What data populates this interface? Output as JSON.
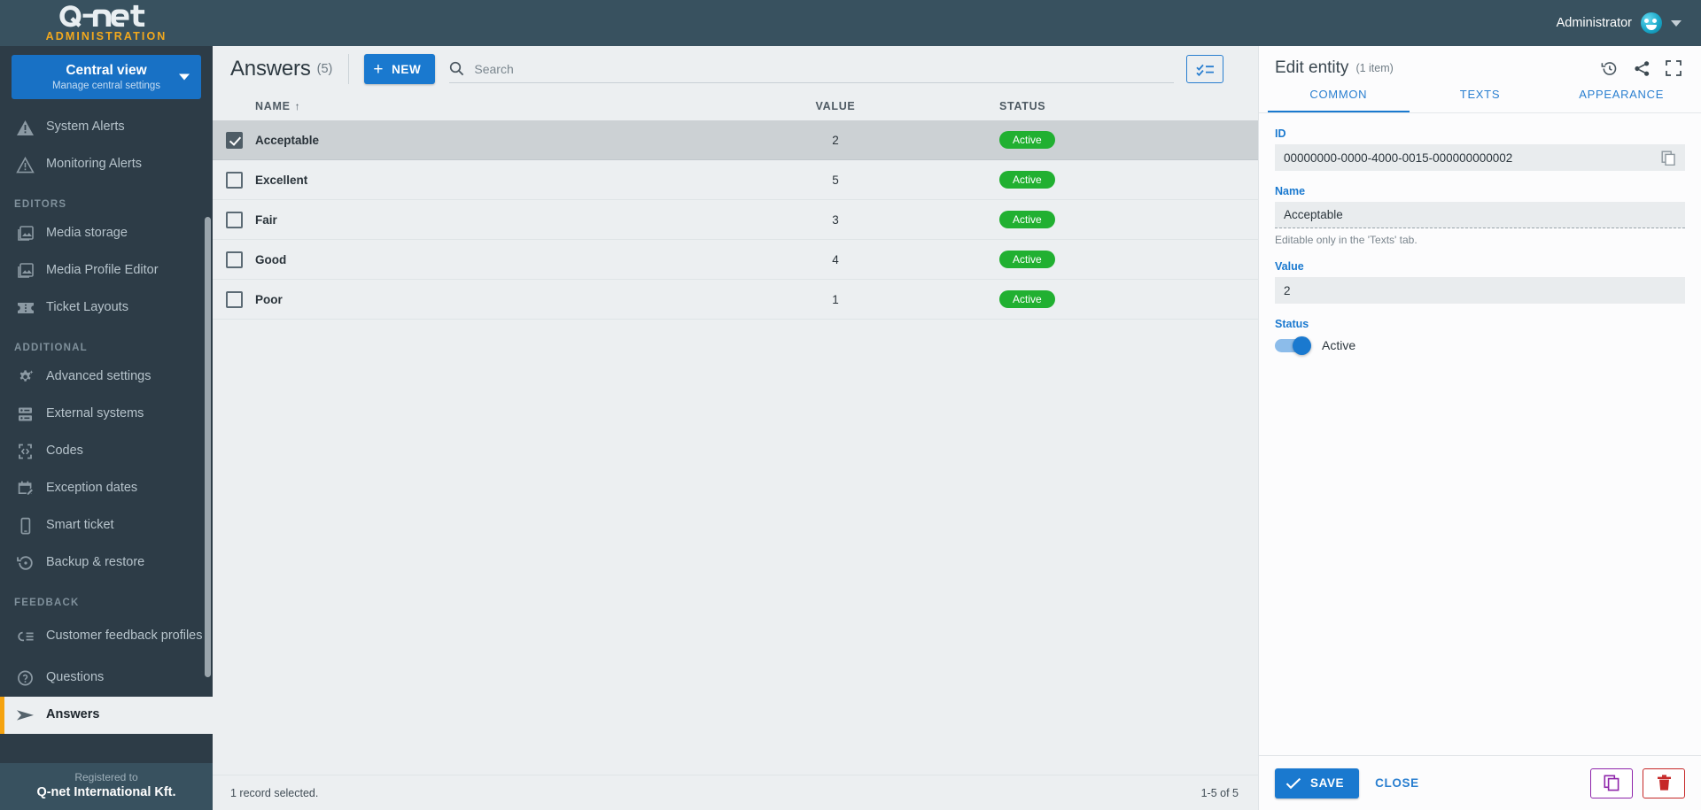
{
  "brand": {
    "logo_main": "Q⌐net",
    "logo_sub": "ADMINISTRATION"
  },
  "topbar": {
    "user_label": "Administrator",
    "avatar_icon": "smiley-avatar-icon",
    "caret_icon": "chevron-down-icon"
  },
  "sidebar": {
    "view_switch": {
      "title": "Central view",
      "subtitle": "Manage central settings",
      "caret_icon": "chevron-down-icon"
    },
    "items": [
      {
        "label": "System Alerts",
        "icon": "alert-filled-icon",
        "group": null,
        "active": false
      },
      {
        "label": "Monitoring Alerts",
        "icon": "alert-outline-icon",
        "group": null,
        "active": false
      }
    ],
    "groups": [
      {
        "title": "EDITORS",
        "items": [
          {
            "label": "Media storage",
            "icon": "image-stack-icon",
            "active": false
          },
          {
            "label": "Media Profile Editor",
            "icon": "image-folder-icon",
            "active": false
          },
          {
            "label": "Ticket Layouts",
            "icon": "ticket-icon",
            "active": false
          }
        ]
      },
      {
        "title": "ADDITIONAL",
        "items": [
          {
            "label": "Advanced settings",
            "icon": "gear-sparkle-icon",
            "active": false
          },
          {
            "label": "External systems",
            "icon": "server-icon",
            "active": false
          },
          {
            "label": "Codes",
            "icon": "code-brackets-icon",
            "active": false
          },
          {
            "label": "Exception dates",
            "icon": "calendar-edit-icon",
            "active": false
          },
          {
            "label": "Smart ticket",
            "icon": "mobile-phone-icon",
            "active": false
          },
          {
            "label": "Backup & restore",
            "icon": "restore-clock-icon",
            "active": false
          }
        ]
      },
      {
        "title": "FEEDBACK",
        "items": [
          {
            "label": "Customer feedback profiles",
            "icon": "feedback-list-icon",
            "active": false
          },
          {
            "label": "Questions",
            "icon": "question-circle-icon",
            "active": false
          },
          {
            "label": "Answers",
            "icon": "send-arrow-icon",
            "active": true
          }
        ]
      }
    ],
    "registered": {
      "caption": "Registered to",
      "company": "Q-net International Kft."
    }
  },
  "main": {
    "title": "Answers",
    "count_label": "(5)",
    "new_button": {
      "label": "NEW",
      "icon": "plus-icon"
    },
    "search": {
      "placeholder": "Search",
      "value": "",
      "icon": "search-icon"
    },
    "checklist_button_icon": "checklist-icon",
    "table": {
      "columns": [
        "NAME",
        "VALUE",
        "STATUS"
      ],
      "sort_column": "NAME",
      "sort_icon": "↑",
      "rows": [
        {
          "name": "Acceptable",
          "value": "2",
          "status": "Active",
          "selected": true
        },
        {
          "name": "Excellent",
          "value": "5",
          "status": "Active",
          "selected": false
        },
        {
          "name": "Fair",
          "value": "3",
          "status": "Active",
          "selected": false
        },
        {
          "name": "Good",
          "value": "4",
          "status": "Active",
          "selected": false
        },
        {
          "name": "Poor",
          "value": "1",
          "status": "Active",
          "selected": false
        }
      ]
    },
    "footer": {
      "selection_text": "1 record selected.",
      "pagination_text": "1-5 of 5"
    }
  },
  "right_panel": {
    "title": "Edit entity",
    "item_count_label": "(1 item)",
    "head_icons": [
      "history-icon",
      "share-icon",
      "fullscreen-icon"
    ],
    "tabs": [
      {
        "label": "COMMON",
        "active": true
      },
      {
        "label": "TEXTS",
        "active": false
      },
      {
        "label": "APPEARANCE",
        "active": false
      }
    ],
    "fields": {
      "id": {
        "label": "ID",
        "value": "00000000-0000-4000-0015-000000000002",
        "copy_icon": "copy-icon"
      },
      "name": {
        "label": "Name",
        "value": "Acceptable",
        "hint": "Editable only in the 'Texts' tab."
      },
      "value": {
        "label": "Value",
        "value": "2"
      },
      "status": {
        "label": "Status",
        "toggle_label": "Active",
        "toggle_on": true
      }
    },
    "footer": {
      "save_label": "SAVE",
      "save_icon": "check-icon",
      "close_label": "CLOSE",
      "duplicate_icon": "copy-icon",
      "delete_icon": "trash-icon"
    }
  },
  "colors": {
    "accent_blue": "#1a79cf",
    "brand_orange": "#f2a81d",
    "status_green": "#21b031",
    "sidebar_dark": "#2d3c47",
    "topbar": "#38515f",
    "delete_red": "#c62828",
    "duplicate_purple": "#8e24aa"
  }
}
